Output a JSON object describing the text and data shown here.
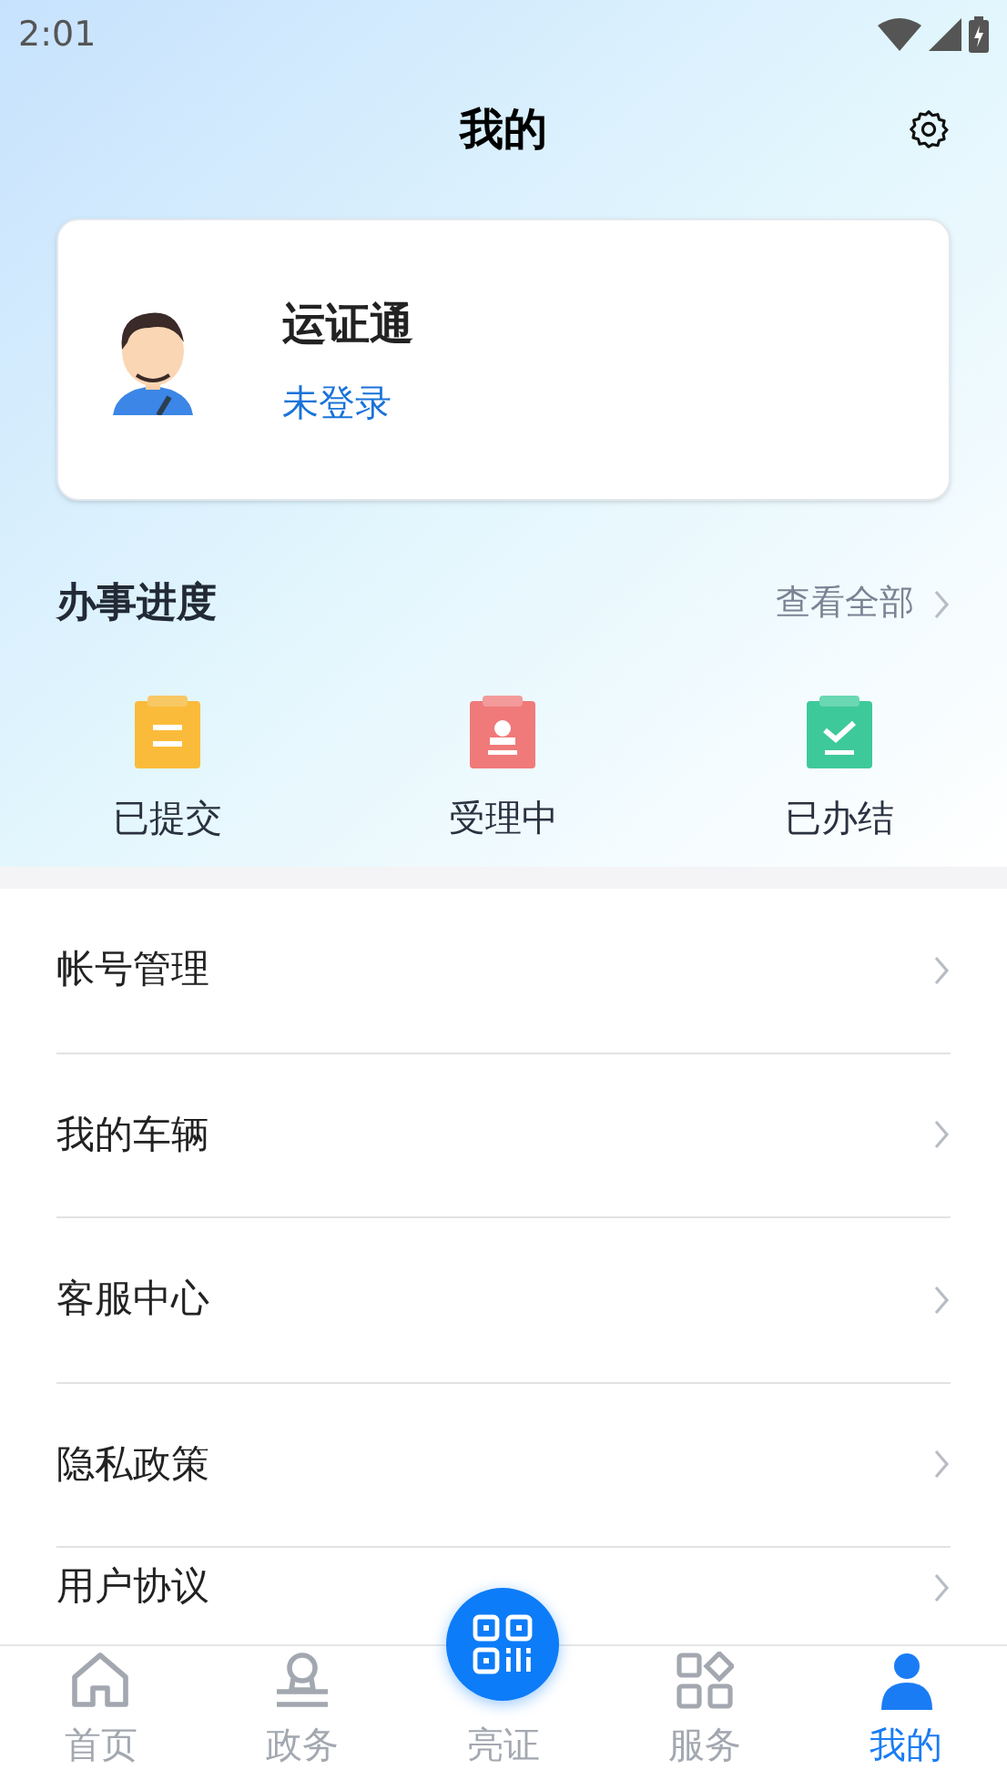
{
  "status_bar": {
    "time": "2:01"
  },
  "header": {
    "title": "我的"
  },
  "profile": {
    "name": "运证通",
    "login_status": "未登录"
  },
  "progress": {
    "title": "办事进度",
    "view_all": "查看全部",
    "items": [
      {
        "label": "已提交"
      },
      {
        "label": "受理中"
      },
      {
        "label": "已办结"
      }
    ]
  },
  "menu": [
    {
      "label": "帐号管理"
    },
    {
      "label": "我的车辆"
    },
    {
      "label": "客服中心"
    },
    {
      "label": "隐私政策"
    },
    {
      "label": "用户协议"
    }
  ],
  "tab_bar": [
    {
      "label": "首页",
      "kind": "plain",
      "selected": false
    },
    {
      "label": "政务",
      "kind": "plain",
      "selected": false
    },
    {
      "label": "亮证",
      "kind": "scan",
      "selected": false
    },
    {
      "label": "服务",
      "kind": "plain",
      "selected": false
    },
    {
      "label": "我的",
      "kind": "plain",
      "selected": true
    }
  ]
}
